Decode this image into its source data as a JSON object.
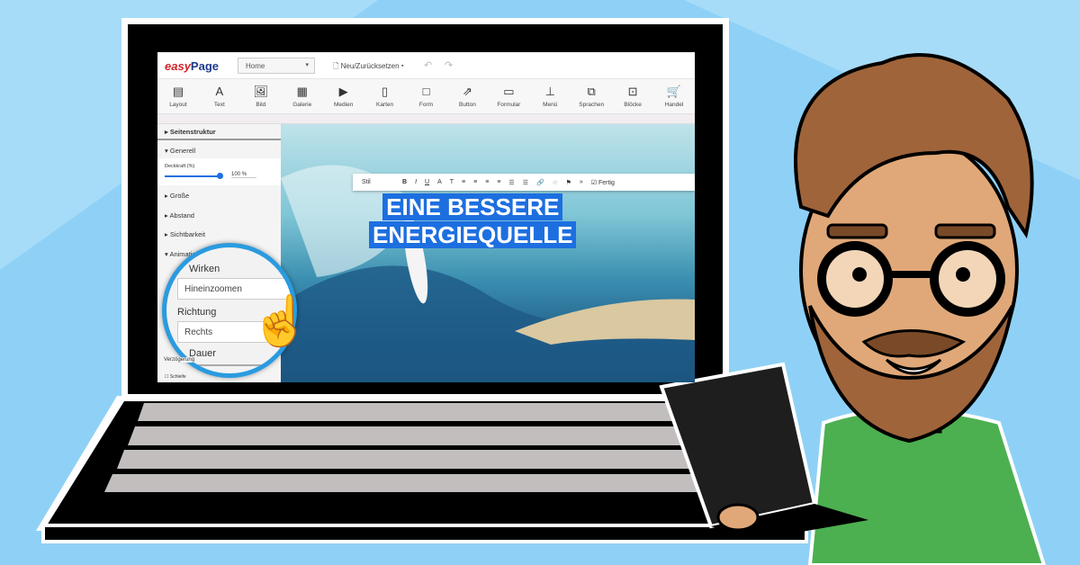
{
  "app": {
    "logo_easy": "easy",
    "logo_page": "Page",
    "page_select": "Home",
    "reset_button": "Neu/Zurücksetzen"
  },
  "toolbar": [
    {
      "label": "Layout",
      "icon": "layout-icon",
      "glyph": "▤"
    },
    {
      "label": "Text",
      "icon": "text-icon",
      "glyph": "A"
    },
    {
      "label": "Bild",
      "icon": "image-icon",
      "glyph": "🖼"
    },
    {
      "label": "Galerie",
      "icon": "gallery-icon",
      "glyph": "▦"
    },
    {
      "label": "Medien",
      "icon": "media-play-icon",
      "glyph": "▶"
    },
    {
      "label": "Karten",
      "icon": "map-icon",
      "glyph": "▯"
    },
    {
      "label": "Form",
      "icon": "shape-icon",
      "glyph": "□"
    },
    {
      "label": "Button",
      "icon": "share-icon",
      "glyph": "⇗"
    },
    {
      "label": "Formular",
      "icon": "form-icon",
      "glyph": "▭"
    },
    {
      "label": "Menü",
      "icon": "sitemap-icon",
      "glyph": "⊥"
    },
    {
      "label": "Sprachen",
      "icon": "language-icon",
      "glyph": "⧉"
    },
    {
      "label": "Blöcke",
      "icon": "blocks-icon",
      "glyph": "⊡"
    },
    {
      "label": "Handel",
      "icon": "cart-icon",
      "glyph": "🛒"
    }
  ],
  "sidebar": {
    "structure": "Seitenstruktur",
    "general": "Generell",
    "opacity_label": "Deckkraft (%)",
    "opacity_value": "100",
    "opacity_unit": "%",
    "opacity_percent": 100,
    "items": [
      "Größe",
      "Abstand",
      "Sichtbarkeit",
      "Animation"
    ],
    "loop": "Schleife"
  },
  "text_toolbar": {
    "style": "Stil",
    "done": "Fertig"
  },
  "headline": {
    "line1": "EINE BESSERE",
    "line2": "ENERGIEQUELLE"
  },
  "magnifier": {
    "effect_label": "Wirken",
    "effect_value": "Hineinzoomen",
    "direction_label": "Richtung",
    "direction_value": "Rechts",
    "duration_label": "Dauer",
    "delay_label": "Verzögerung"
  },
  "colors": {
    "background": "#8fd1f6",
    "accent": "#2a9be0",
    "headline_bg": "#1d6fe0",
    "shirt": "#4caf50"
  }
}
